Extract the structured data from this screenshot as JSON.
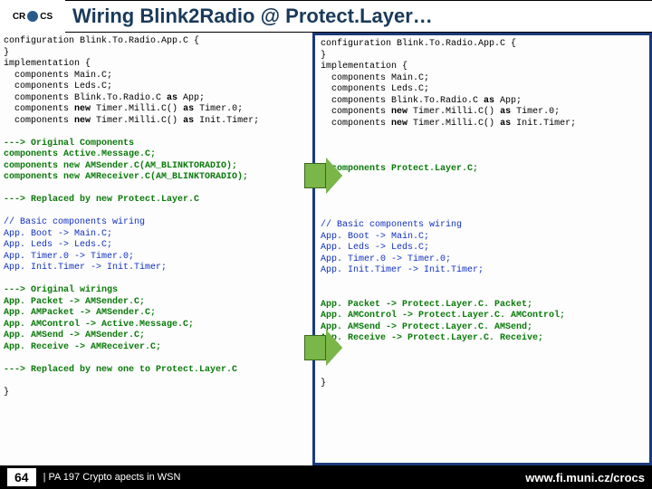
{
  "header": {
    "logo_text": "CR  CS",
    "title": "Wiring Blink2Radio @ Protect.Layer…"
  },
  "left": {
    "config_line": "configuration Blink.To.Radio.App.C {",
    "impl_open": "implementation {",
    "comp_main": "  components Main.C;",
    "comp_leds": "  components Leds.C;",
    "comp_blink_pre": "  components Blink.To.Radio.C ",
    "as_kw": "as",
    "comp_blink_post": " App;",
    "comp_t0_pre": "  components ",
    "new_kw": "new",
    "comp_t0_mid": " Timer.Milli.C() ",
    "comp_t0_post": " Timer.0;",
    "comp_init_mid": " Timer.Milli.C() ",
    "comp_init_post": " Init.Timer;",
    "orig_comp_hdr": "---> Original Components",
    "orig_comp_1": "components Active.Message.C;",
    "orig_comp_2": "components new AMSender.C(AM_BLINKTORADIO);",
    "orig_comp_3": "components new AMReceiver.C(AM_BLINKTORADIO);",
    "replaced_hdr": "---> Replaced by new Protect.Layer.C",
    "basic_hdr": "// Basic components wiring",
    "basic_1": "App. Boot -> Main.C;",
    "basic_2": "App. Leds -> Leds.C;",
    "basic_3": "App. Timer.0 -> Timer.0;",
    "basic_4": "App. Init.Timer -> Init.Timer;",
    "orig_wire_hdr": "---> Original wirings",
    "orig_wire_1": "App. Packet -> AMSender.C;",
    "orig_wire_2": "App. AMPacket -> AMSender.C;",
    "orig_wire_3": "App. AMControl -> Active.Message.C;",
    "orig_wire_4": "App. AMSend -> AMSender.C;",
    "orig_wire_5": "App. Receive -> AMReceiver.C;",
    "replaced_wire_hdr": "---> Replaced by new one to Protect.Layer.C",
    "close_brace": "}"
  },
  "right": {
    "config_line": "configuration Blink.To.Radio.App.C {",
    "impl_open": "implementation {",
    "comp_main": "  components Main.C;",
    "comp_leds": "  components Leds.C;",
    "comp_blink_pre": "  components Blink.To.Radio.C ",
    "comp_blink_post": " App;",
    "comp_t0_pre": "  components ",
    "comp_t0_mid": " Timer.Milli.C() ",
    "comp_t0_post": " Timer.0;",
    "comp_init_mid": " Timer.Milli.C() ",
    "comp_init_post": " Init.Timer;",
    "protect_line": "  components Protect.Layer.C;",
    "basic_hdr": "// Basic components wiring",
    "basic_1": "App. Boot -> Main.C;",
    "basic_2": "App. Leds -> Leds.C;",
    "basic_3": "App. Timer.0 -> Timer.0;",
    "basic_4": "App. Init.Timer -> Init.Timer;",
    "wire_1": "App. Packet -> Protect.Layer.C. Packet;",
    "wire_2": "App. AMControl -> Protect.Layer.C. AMControl;",
    "wire_3": "App. AMSend -> Protect.Layer.C. AMSend;",
    "wire_4": "App. Receive -> Protect.Layer.C. Receive;",
    "close_brace": "}"
  },
  "footer": {
    "slide_num": "64",
    "caption": "| PA 197 Crypto apects in WSN",
    "url": "www.fi.muni.cz/crocs"
  }
}
